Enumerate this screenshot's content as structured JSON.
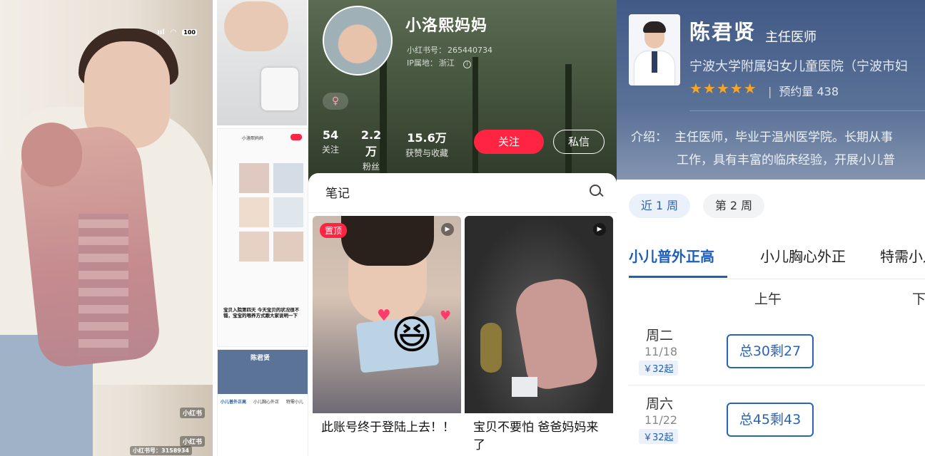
{
  "panel1": {
    "status_signal": "ııl",
    "status_wifi": "◠",
    "status_battery": "100",
    "watermark_1": "小红书",
    "watermark_2": "小红书",
    "watermark_id": "小红书号：3158934"
  },
  "panel2": {
    "mini_profile_name": "小洛熙妈妈",
    "caption": "宝贝入院第四天 今天宝贝的状况很不错，宝宝的喂养方式跟大家说明一下",
    "mini_doctor_name": "陈君贤",
    "mini_tabs": [
      "小儿普外正高",
      "小儿胸心外正",
      "特需小儿"
    ]
  },
  "profile": {
    "username": "小洛熙妈妈",
    "xhs_id_label": "小红书号：",
    "xhs_id": "265440734",
    "ip_label": "IP属地：",
    "ip_value": "浙江",
    "gender_icon": "♀",
    "stats": [
      {
        "value": "54",
        "label": "关注"
      },
      {
        "value": "2.2万",
        "label": "粉丝"
      },
      {
        "value": "15.6万",
        "label": "获赞与收藏"
      }
    ],
    "follow_button": "关注",
    "message_button": "私信",
    "notes_tab": "笔记",
    "notes": [
      {
        "pinned_badge": "置顶",
        "title": "此账号终于登陆上去！！",
        "type_icon": "video-icon"
      },
      {
        "pinned_badge": "",
        "title": "宝贝不要怕 爸爸妈妈来了",
        "type_icon": "video-icon"
      }
    ]
  },
  "doctor": {
    "name": "陈君贤",
    "title": "主任医师",
    "hospital": "宁波大学附属妇女儿童医院（宁波市妇",
    "rating_stars": "★★★★★",
    "rating": 5,
    "appointments_label": "预约量",
    "appointments": "438",
    "intro_key": "介绍：",
    "intro_line1": "主任医师，毕业于温州医学院。长期从事",
    "intro_line2": "工作，具有丰富的临床经验，开展小儿普",
    "week_tabs": [
      "近 1 周",
      "第 2 周"
    ],
    "departments": [
      "小儿普外正高",
      "小儿胸心外正",
      "特需小儿"
    ],
    "am_label": "上午",
    "pm_label": "下",
    "schedule": [
      {
        "day": "周二",
        "date": "11/18",
        "price": "￥32起",
        "slot": "总30剩27"
      },
      {
        "day": "周六",
        "date": "11/22",
        "price": "￥32起",
        "slot": "总45剩43"
      }
    ]
  },
  "colors": {
    "xhs_red": "#ff2442",
    "doctor_blue": "#1e5fb8",
    "star_gold": "#f6a623"
  }
}
